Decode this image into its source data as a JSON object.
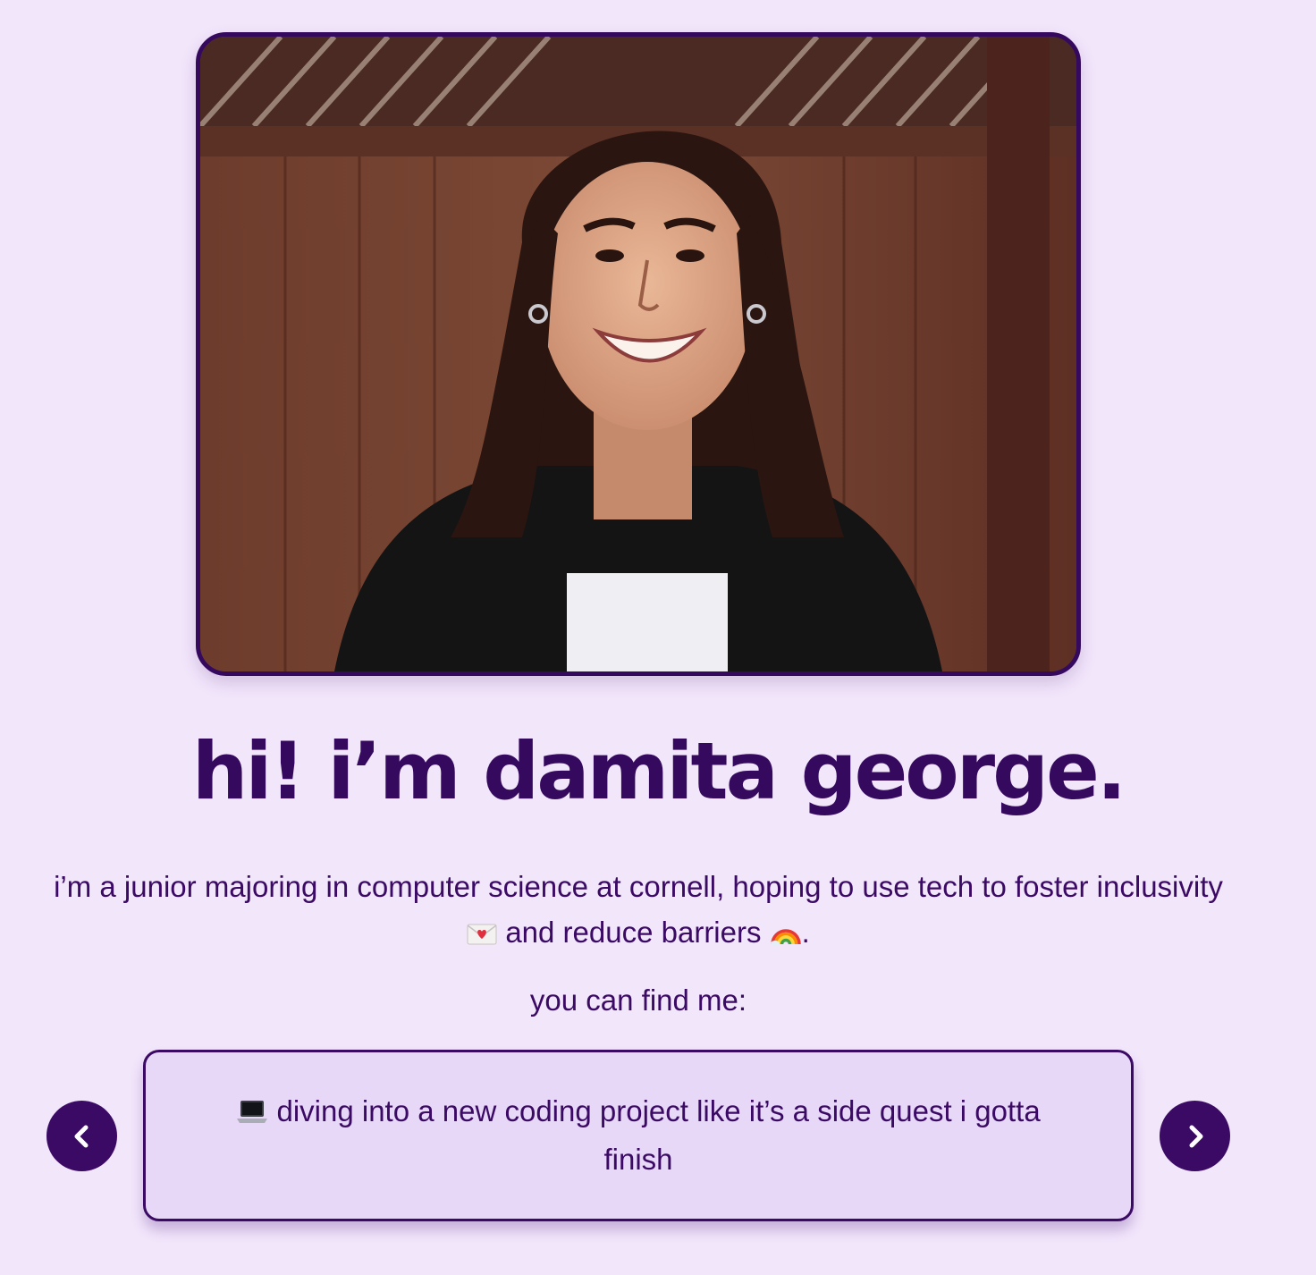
{
  "profile": {
    "photo_icon": "portrait-photo",
    "title": "hi! i’m damita george.",
    "intro_before_heart": "i’m a junior majoring in computer science at cornell, hoping to use tech to foster inclusivity",
    "intro_between": "and reduce barriers",
    "intro_end": ".",
    "heart_icon": "love-letter-emoji",
    "rainbow_icon": "rainbow-emoji",
    "find_me": "you can find me:"
  },
  "carousel": {
    "prev_icon": "chevron-left-icon",
    "next_icon": "chevron-right-icon",
    "current_item": {
      "icon": "laptop-emoji",
      "text": "diving into a new coding project like it’s a side quest i gotta finish"
    }
  },
  "colors": {
    "background": "#f2e6fb",
    "primary": "#35095e",
    "card": "#e8d8f8"
  }
}
